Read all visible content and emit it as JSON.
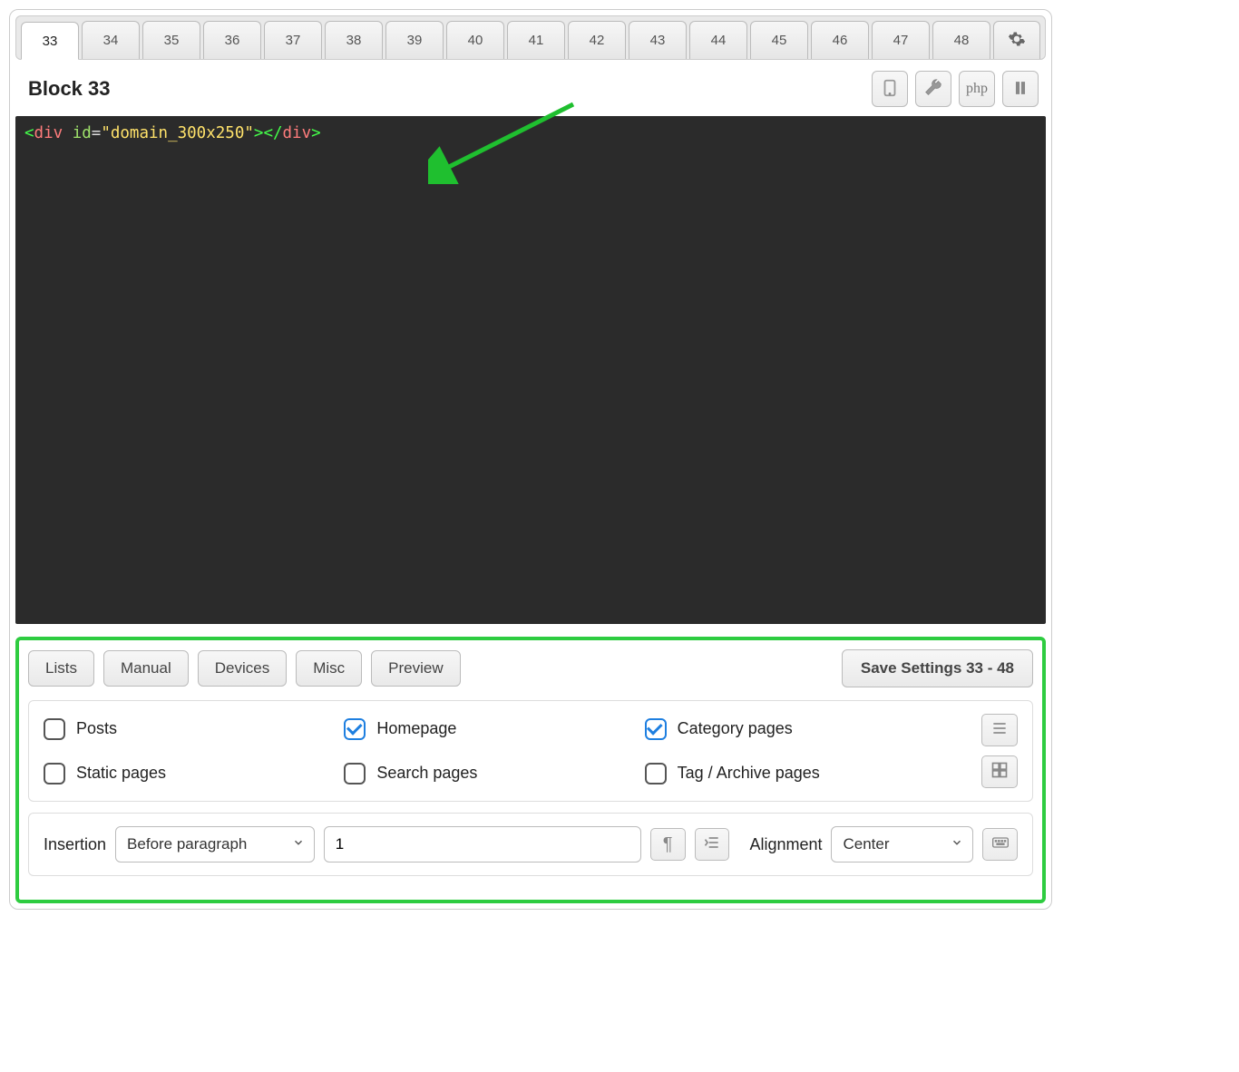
{
  "tabs": [
    "33",
    "34",
    "35",
    "36",
    "37",
    "38",
    "39",
    "40",
    "41",
    "42",
    "43",
    "44",
    "45",
    "46",
    "47",
    "48"
  ],
  "active_tab": "33",
  "block_title": "Block 33",
  "toolbar": {
    "php_label": "php"
  },
  "code": {
    "tag_open": "div",
    "attr": "id",
    "value": "\"domain_300x250\"",
    "tag_close": "div"
  },
  "buttons": {
    "lists": "Lists",
    "manual": "Manual",
    "devices": "Devices",
    "misc": "Misc",
    "preview": "Preview",
    "save": "Save Settings 33 - 48"
  },
  "checks": {
    "posts": {
      "label": "Posts",
      "checked": false
    },
    "homepage": {
      "label": "Homepage",
      "checked": true
    },
    "category": {
      "label": "Category pages",
      "checked": true
    },
    "static": {
      "label": "Static pages",
      "checked": false
    },
    "search": {
      "label": "Search pages",
      "checked": false
    },
    "tagarchive": {
      "label": "Tag / Archive pages",
      "checked": false
    }
  },
  "insertion": {
    "label": "Insertion",
    "value": "Before paragraph",
    "number": "1",
    "alignment_label": "Alignment",
    "alignment_value": "Center"
  }
}
